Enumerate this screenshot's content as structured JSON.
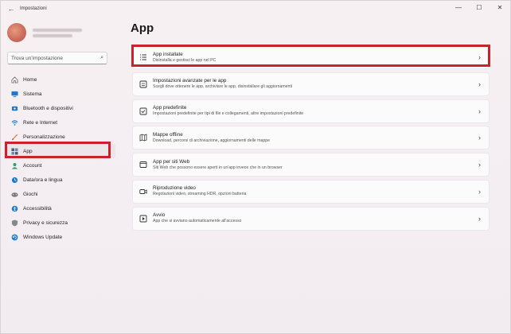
{
  "window": {
    "title": "Impostazioni",
    "back_glyph": "←",
    "controls": [
      "—",
      "☐",
      "✕"
    ]
  },
  "sidebar": {
    "search_placeholder": "Trova un'impostazione",
    "items": [
      {
        "label": "Home",
        "icon": "home-icon",
        "color": "#8a8a8a"
      },
      {
        "label": "Sistema",
        "icon": "system-icon",
        "color": "#1a7ad1"
      },
      {
        "label": "Bluetooth e dispositivi",
        "icon": "bluetooth-icon",
        "color": "#1a7ad1"
      },
      {
        "label": "Rete e Internet",
        "icon": "wifi-icon",
        "color": "#1a7ad1"
      },
      {
        "label": "Personalizzazione",
        "icon": "brush-icon",
        "color": "#e07a2c"
      },
      {
        "label": "App",
        "icon": "apps-icon",
        "color": "#4a5d7a"
      },
      {
        "label": "Account",
        "icon": "account-icon",
        "color": "#2aa36b"
      },
      {
        "label": "Data/ora e lingua",
        "icon": "globe-clock-icon",
        "color": "#1a7ad1"
      },
      {
        "label": "Giochi",
        "icon": "controller-icon",
        "color": "#666"
      },
      {
        "label": "Accessibilità",
        "icon": "accessibility-icon",
        "color": "#1a7ad1"
      },
      {
        "label": "Privacy e sicurezza",
        "icon": "shield-icon",
        "color": "#777"
      },
      {
        "label": "Windows Update",
        "icon": "update-icon",
        "color": "#1a7ad1"
      }
    ],
    "active_index": 5
  },
  "main": {
    "title": "App",
    "cards": [
      {
        "title": "App installate",
        "desc": "Disinstalla e gestisci le app nel PC",
        "icon": "list-icon"
      },
      {
        "title": "Impostazioni avanzate per le app",
        "desc": "Scegli dove ottenere le app, archiviare le app, disinstallare gli aggiornamenti",
        "icon": "advanced-apps-icon"
      },
      {
        "title": "App predefinite",
        "desc": "Impostazioni predefinite per tipi di file e collegamenti, altre impostazioni predefinite",
        "icon": "default-apps-icon"
      },
      {
        "title": "Mappe offline",
        "desc": "Download, percorsi di archiviazione, aggiornamenti delle mappe",
        "icon": "map-icon"
      },
      {
        "title": "App per siti Web",
        "desc": "Siti Web che possono essere aperti in un'app invece che in un browser",
        "icon": "website-app-icon"
      },
      {
        "title": "Riproduzione video",
        "desc": "Regolazioni video, streaming HDR, opzioni batteria",
        "icon": "video-icon"
      },
      {
        "title": "Avvio",
        "desc": "App che si avviano automaticamente all'accesso",
        "icon": "startup-icon"
      }
    ]
  },
  "accent_color": "#0a64c0",
  "highlight_color": "#c8232c"
}
